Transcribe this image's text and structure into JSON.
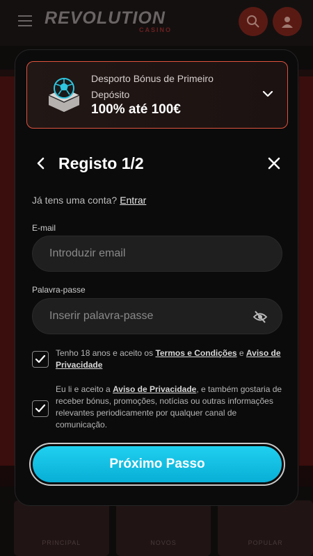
{
  "background": {
    "logo": "REVOLUTION",
    "logo_sub": "CASINO",
    "tiles": [
      "PRINCIPAL",
      "NOVOS",
      "POPULAR"
    ]
  },
  "bonus": {
    "line1": "Desporto Bónus de Primeiro",
    "line2": "Depósito",
    "amount": "100% até 100€",
    "icon": "football-icon"
  },
  "header": {
    "title": "Registo 1/2",
    "back_icon": "chevron-left-icon",
    "close_icon": "close-icon"
  },
  "login": {
    "prompt": "Já tens uma conta?",
    "link": "Entrar"
  },
  "form": {
    "email_label": "E-mail",
    "email_placeholder": "Introduzir email",
    "email_value": "",
    "password_label": "Palavra-passe",
    "password_placeholder": "Inserir palavra-passe",
    "password_value": "",
    "eye_icon": "eye-off-icon"
  },
  "consents": [
    {
      "checked": true,
      "text_before": "Tenho 18 anos e aceito os ",
      "link1": "Termos e Condições",
      "text_middle": " e ",
      "link2": "Aviso de Privacidade"
    },
    {
      "checked": true,
      "text_before": "Eu li e aceito a ",
      "link1": "Aviso de Privacidade",
      "text_after": ", e também gostaria de receber bónus, promoções, notícias ou outras informações relevantes periodicamente por qualquer canal de comunicação."
    }
  ],
  "next_button": {
    "label": "Próximo Passo"
  },
  "colors": {
    "accent": "#13c2e6",
    "bonus_border": "#e0533f",
    "modal_bg": "#0b0b0b"
  }
}
